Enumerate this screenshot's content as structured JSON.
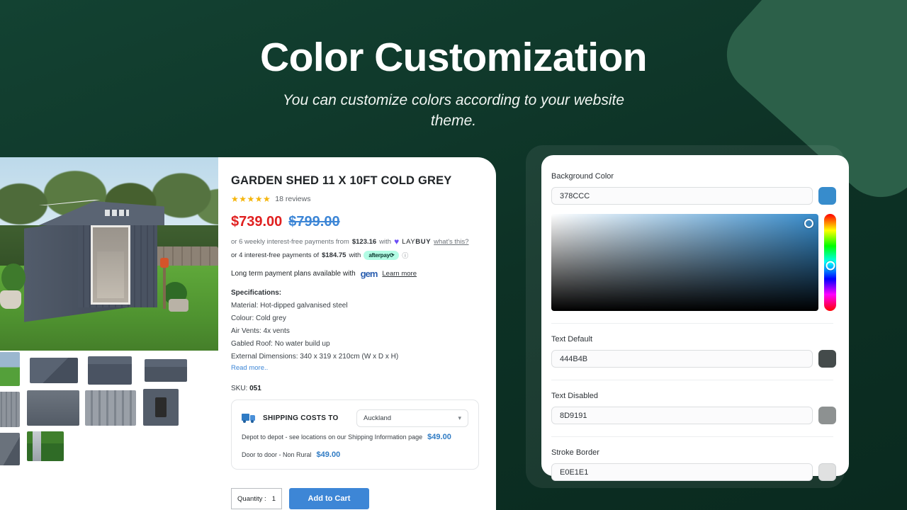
{
  "header": {
    "title": "Color Customization",
    "subtitle": "You can customize colors according to your website theme."
  },
  "product": {
    "title": "GARDEN SHED 11 X 10FT COLD GREY",
    "stars": "★★★★★",
    "reviews": "18 reviews",
    "price_current": "$739.00",
    "price_original": "$799.00",
    "laybuy": {
      "prefix": "or 6 weekly interest-free payments from",
      "amount": "$123.16",
      "with": "with",
      "brand_light": "LAY",
      "brand_bold": "BUY",
      "link": "what's this?"
    },
    "afterpay": {
      "prefix": "or 4 interest-free payments of",
      "amount": "$184.75",
      "with": "with",
      "brand": "afterpay⟳",
      "info": "ⓘ"
    },
    "gem": {
      "text": "Long term payment plans available with",
      "brand": "gem",
      "link": "Learn more"
    },
    "spec_heading": "Specifications:",
    "specs": [
      "Material: Hot-dipped galvanised steel",
      "Colour: Cold grey",
      "Air Vents: 4x vents",
      "Gabled Roof: No water build up",
      "External Dimensions: 340 x 319 x 210cm (W x D x H)"
    ],
    "read_more": "Read more..",
    "sku_label": "SKU:",
    "sku_value": "051",
    "shipping": {
      "title": "SHIPPING COSTS TO",
      "region": "Auckland",
      "rows": [
        {
          "label": "Depot to depot - see locations on our Shipping Information page",
          "price": "$49.00"
        },
        {
          "label": "Door to door - Non Rural",
          "price": "$49.00"
        }
      ]
    },
    "quantity_label": "Quantity :",
    "quantity_value": "1",
    "add_to_cart": "Add to Cart"
  },
  "color_panel": {
    "fields": [
      {
        "label": "Background Color",
        "value": "378CCC",
        "swatch": "#378CCC"
      },
      {
        "label": "Text Default",
        "value": "444B4B",
        "swatch": "#444B4B"
      },
      {
        "label": "Text Disabled",
        "value": "8D9191",
        "swatch": "#8D9191"
      },
      {
        "label": "Stroke Border",
        "value": "E0E1E1",
        "swatch": "#E0E1E1"
      }
    ]
  }
}
